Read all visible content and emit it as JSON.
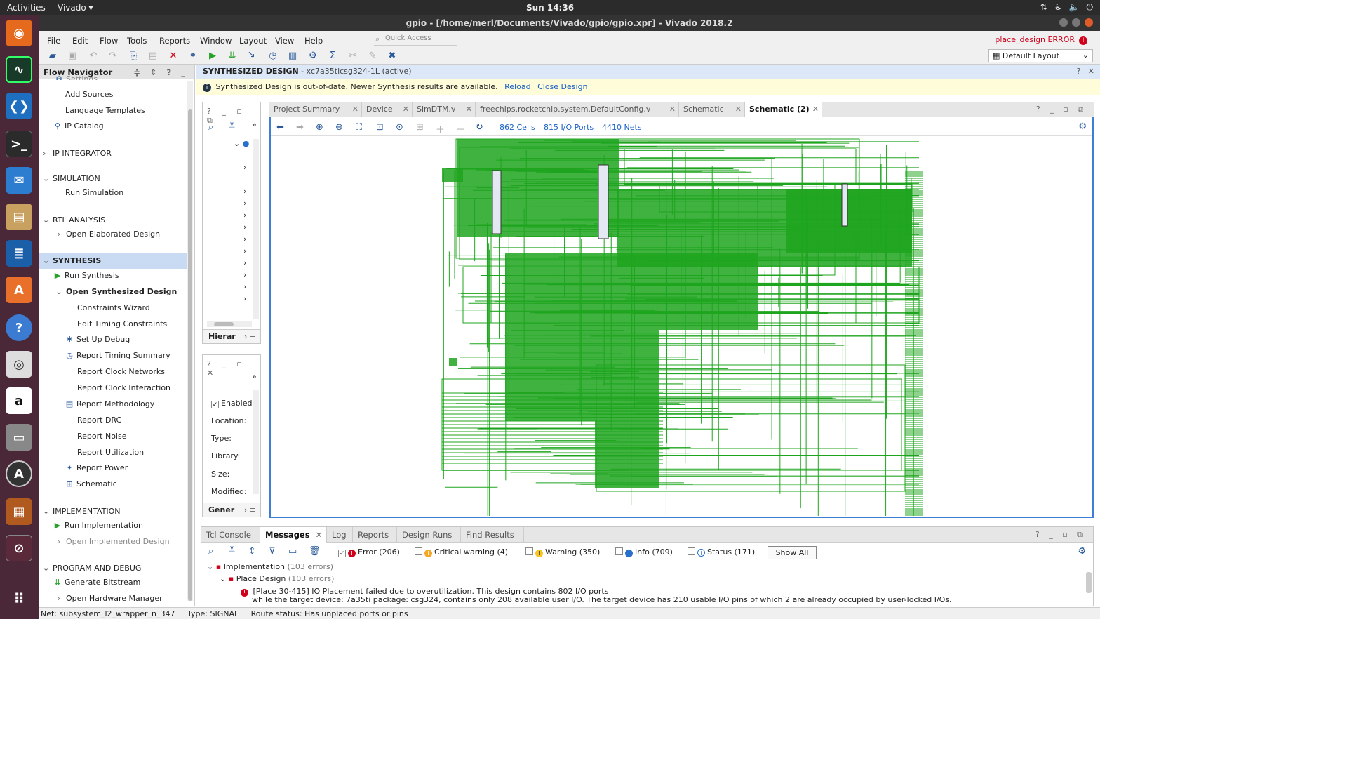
{
  "topbar": {
    "activities": "Activities",
    "app_name": "Vivado ▾",
    "clock": "Sun 14:36"
  },
  "window": {
    "title": "gpio - [/home/merl/Documents/Vivado/gpio/gpio.xpr] - Vivado 2018.2"
  },
  "menubar": {
    "items": [
      "File",
      "Edit",
      "Flow",
      "Tools",
      "Reports",
      "Window",
      "Layout",
      "View",
      "Help"
    ],
    "quick_access_placeholder": "Quick Access",
    "error_status": "place_design ERROR"
  },
  "toolbar": {
    "layout_select": "Default Layout"
  },
  "flow_navigator": {
    "title": "Flow Navigator",
    "items": {
      "settings": "Settings",
      "add_sources": "Add Sources",
      "language_templates": "Language Templates",
      "ip_catalog": "IP Catalog",
      "ip_integrator": "IP INTEGRATOR",
      "simulation": "SIMULATION",
      "run_simulation": "Run Simulation",
      "rtl_analysis": "RTL ANALYSIS",
      "open_elaborated": "Open Elaborated Design",
      "synthesis": "SYNTHESIS",
      "run_synthesis": "Run Synthesis",
      "open_synth": "Open Synthesized Design",
      "constraints_wizard": "Constraints Wizard",
      "edit_timing": "Edit Timing Constraints",
      "set_up_debug": "Set Up Debug",
      "report_timing": "Report Timing Summary",
      "report_clock_networks": "Report Clock Networks",
      "report_clock_interaction": "Report Clock Interaction",
      "report_methodology": "Report Methodology",
      "report_drc": "Report DRC",
      "report_noise": "Report Noise",
      "report_utilization": "Report Utilization",
      "report_power": "Report Power",
      "schematic": "Schematic",
      "implementation": "IMPLEMENTATION",
      "run_implementation": "Run Implementation",
      "open_implemented": "Open Implemented Design",
      "program_debug": "PROGRAM AND DEBUG",
      "generate_bitstream": "Generate Bitstream",
      "open_hw_manager": "Open Hardware Manager"
    }
  },
  "design_header": {
    "title": "SYNTHESIZED DESIGN",
    "part": " - xc7a35ticsg324-1L",
    "state": "(active)"
  },
  "banner": {
    "message": "Synthesized Design is out-of-date. Newer Synthesis results are available.",
    "reload": "Reload",
    "close": "Close Design"
  },
  "left_panels": {
    "hier_tab": "Hierar",
    "props": {
      "enabled": "Enabled",
      "location": "Location:",
      "type": "Type:",
      "library": "Library:",
      "size": "Size:",
      "modified": "Modified:"
    },
    "gen_tab": "Gener"
  },
  "editor_tabs": [
    {
      "label": "Project Summary"
    },
    {
      "label": "Device"
    },
    {
      "label": "SimDTM.v"
    },
    {
      "label": "freechips.rocketchip.system.DefaultConfig.v"
    },
    {
      "label": "Schematic"
    },
    {
      "label": "Schematic (2)"
    }
  ],
  "schematic": {
    "cells": "862 Cells",
    "ports": "815 I/O Ports",
    "nets": "4410 Nets",
    "wire_color": "#1ea51e"
  },
  "messages_panel": {
    "tabs": [
      "Tcl Console",
      "Messages",
      "Log",
      "Reports",
      "Design Runs",
      "Find Results"
    ],
    "filters": {
      "error": "Error (206)",
      "critical": "Critical warning (4)",
      "warning": "Warning (350)",
      "info": "Info (709)",
      "status": "Status (171)",
      "show_all": "Show All"
    },
    "tree": {
      "impl": "Implementation",
      "impl_count": "(103 errors)",
      "place": "Place Design",
      "place_count": "(103 errors)",
      "msg_line1": "[Place 30-415] IO Placement failed due to overutilization. This design contains 802 I/O ports",
      "msg_line2": "while the target device: 7a35ti package: csg324, contains only 208 available user I/O. The target device has 210 usable I/O pins of which 2 are already occupied by user-locked I/Os."
    }
  },
  "statusbar": {
    "net": "Net: subsystem_l2_wrapper_n_347",
    "type": "Type: SIGNAL",
    "route": "Route status: Has unplaced ports or pins"
  },
  "colors": {
    "accent": "#3d7fd6",
    "error": "#d0021b",
    "warning": "#f5a623",
    "info": "#2a6fc9"
  }
}
